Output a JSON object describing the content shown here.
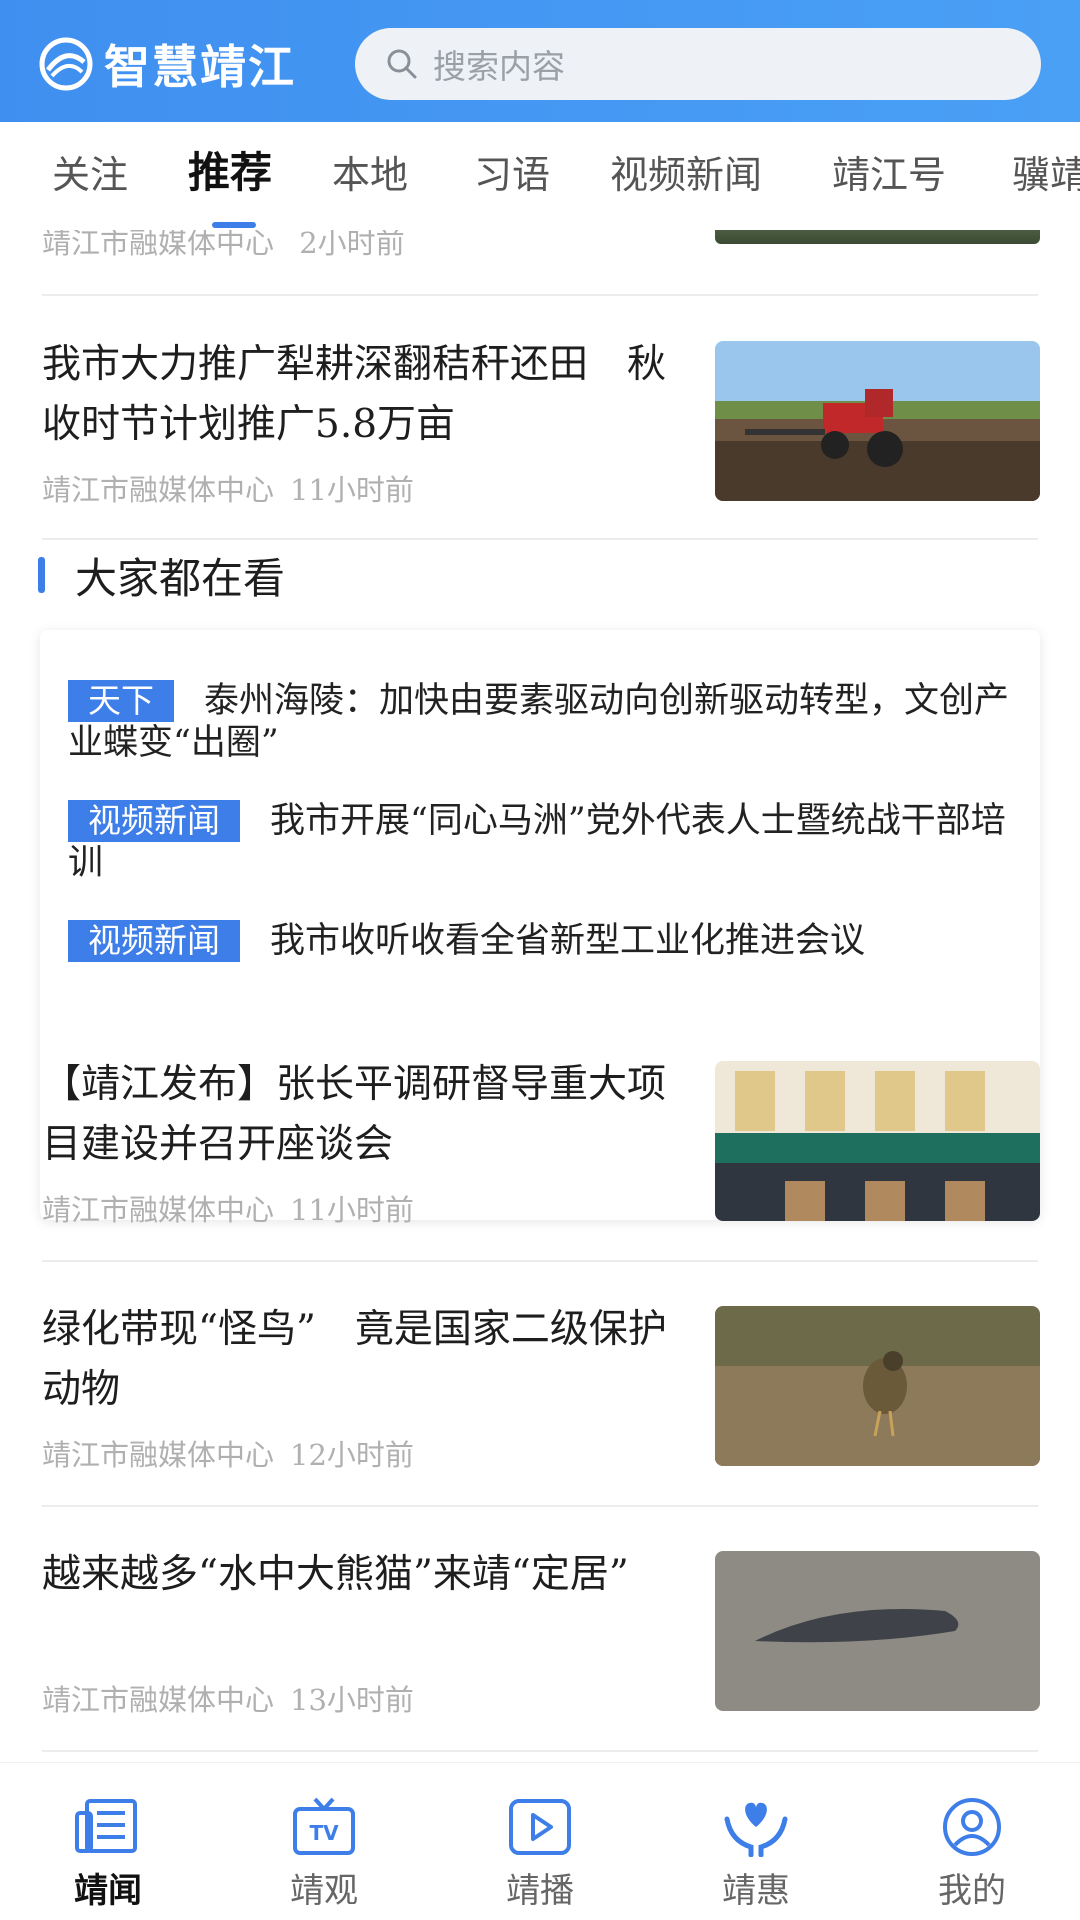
{
  "header": {
    "logo_text": "智慧靖江",
    "search_placeholder": "搜索内容"
  },
  "tabs": [
    "关注",
    "推荐",
    "本地",
    "习语",
    "视频新闻",
    "靖江号",
    "骥靖"
  ],
  "active_tab": "推荐",
  "partial_item": {
    "source": "靖江市融媒体中心",
    "time": "2小时前"
  },
  "news_top": {
    "title": "我市大力推广犁耕深翻秸秆还田　秋收时节计划推广5.8万亩",
    "source": "靖江市融媒体中心",
    "time": "11小时前"
  },
  "hot_section": {
    "title": "大家都在看",
    "items": [
      {
        "tag": "天下",
        "text": "泰州海陵：加快由要素驱动向创新驱动转型，文创产业蝶变“出圈”"
      },
      {
        "tag": "视频新闻",
        "text": "我市开展“同心马洲”党外代表人士暨统战干部培训"
      },
      {
        "tag": "视频新闻",
        "text": "我市收听收看全省新型工业化推进会议"
      }
    ]
  },
  "news_list": [
    {
      "title": "【靖江发布】张长平调研督导重大项目建设并召开座谈会",
      "source": "靖江市融媒体中心",
      "time": "11小时前"
    },
    {
      "title": "绿化带现“怪鸟”　竟是国家二级保护动物",
      "source": "靖江市融媒体中心",
      "time": "12小时前"
    },
    {
      "title": "越来越多“水中大熊猫”来靖“定居”",
      "source": "靖江市融媒体中心",
      "time": "13小时前"
    }
  ],
  "bottom_nav": [
    {
      "label": "靖闻",
      "icon": "newspaper-icon"
    },
    {
      "label": "靖观",
      "icon": "tv-icon"
    },
    {
      "label": "靖播",
      "icon": "play-icon"
    },
    {
      "label": "靖惠",
      "icon": "heart-hands-icon"
    },
    {
      "label": "我的",
      "icon": "profile-icon"
    }
  ],
  "colors": {
    "accent": "#3d7ee8",
    "header": "#4a9af3",
    "meta": "#b0b0b0"
  }
}
